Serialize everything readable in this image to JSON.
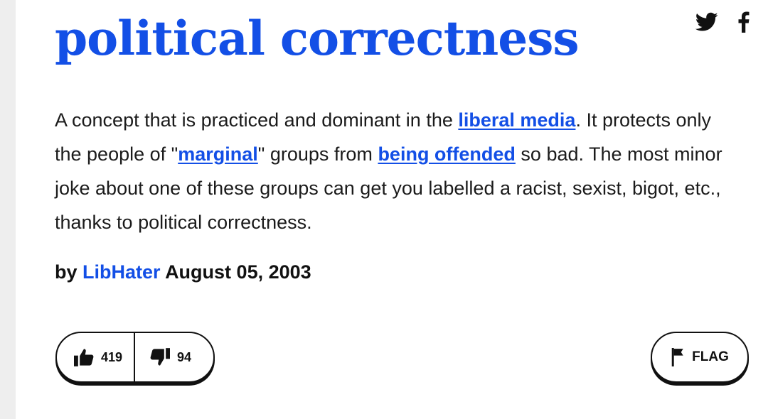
{
  "entry": {
    "word": "political correctness",
    "meaning_segments": [
      {
        "text": "A concept that is practiced and dominant in the ",
        "link": false
      },
      {
        "text": "liberal media",
        "link": true
      },
      {
        "text": ". It protects only the people of \"",
        "link": false
      },
      {
        "text": "marginal",
        "link": true
      },
      {
        "text": "\" groups from ",
        "link": false
      },
      {
        "text": "being offended",
        "link": true
      },
      {
        "text": " so bad. The most minor joke about one of these groups can get you labelled a racist, sexist, bigot, etc., thanks to political correctness.",
        "link": false
      }
    ],
    "contributor_prefix": "by",
    "author": "LibHater",
    "date": "August 05, 2003"
  },
  "votes": {
    "up_count": "419",
    "down_count": "94"
  },
  "flag_label": "FLAG",
  "share": {
    "icons": [
      "twitter-icon",
      "facebook-icon"
    ]
  },
  "colors": {
    "link": "#134fe6",
    "text": "#1b1b1b",
    "background": "#ffffff",
    "page_gutter": "#eeeeee"
  }
}
